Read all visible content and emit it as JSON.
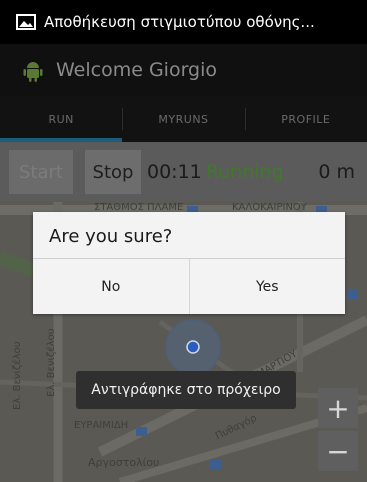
{
  "status_bar": {
    "notification_text": "Αποθήκευση στιγμιοτύπου οθόνης...",
    "icon": "image-icon"
  },
  "action_bar": {
    "title": "Welcome Giorgio",
    "icon": "android-icon"
  },
  "tabs": [
    {
      "label": "RUN",
      "selected": true
    },
    {
      "label": "MYRUNS",
      "selected": false
    },
    {
      "label": "PROFILE",
      "selected": false
    }
  ],
  "controls": {
    "start_label": "Start",
    "stop_label": "Stop",
    "time": "00:11",
    "status": "Running",
    "distance": "0 m"
  },
  "map": {
    "labels": {
      "top_left_street": "ΣΤΑΘΜΟΣ ΠΛΑΜΕ",
      "top_right_street": "ΚΑΛΟΚΑΙΡΙΝΟΥ",
      "vertical_street": "Ελ. Βενιζέλου",
      "vertical_street_short": "Ελ. Βενιζέλου",
      "lower_left": "ΕΥΡΑΙΜΙΔΗ",
      "diagonal_street": "Πυθαγόρ",
      "bottom_street": "Αργοστολίου",
      "diagonal_upper": "ΜΑΡΤΙΟΥ"
    },
    "zoom_in": "+",
    "zoom_out": "−"
  },
  "dialog": {
    "title": "Are you sure?",
    "no_label": "No",
    "yes_label": "Yes"
  },
  "toast": {
    "text": "Αντιγράφηκε στο πρόχειρο"
  },
  "colors": {
    "running_green": "#3f7a2a",
    "tab_indicator": "#1d5f7a",
    "location_blue": "#2b5dbf"
  }
}
